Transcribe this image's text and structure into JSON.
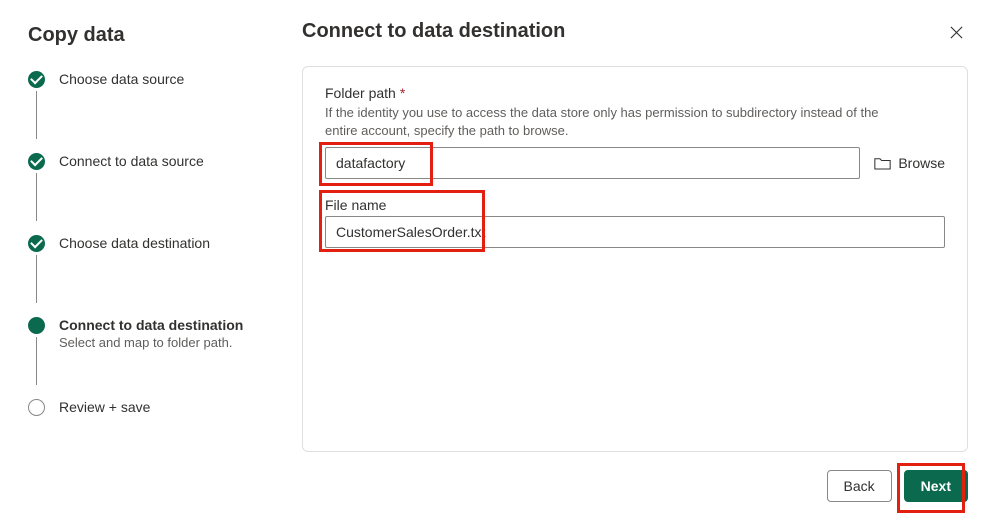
{
  "wizard": {
    "title": "Copy data",
    "steps": [
      {
        "label": "Choose data source",
        "status": "done"
      },
      {
        "label": "Connect to data source",
        "status": "done"
      },
      {
        "label": "Choose data destination",
        "status": "done"
      },
      {
        "label": "Connect to data destination",
        "status": "current",
        "sub": "Select and map to folder path."
      },
      {
        "label": "Review + save",
        "status": "pending"
      }
    ]
  },
  "page": {
    "title": "Connect to data destination"
  },
  "fields": {
    "folderPath": {
      "label": "Folder path",
      "required": true,
      "desc": "If the identity you use to access the data store only has permission to subdirectory instead of the entire account, specify the path to browse.",
      "value": "datafactory",
      "browse_label": "Browse"
    },
    "fileName": {
      "label": "File name",
      "value": "CustomerSalesOrder.txt"
    }
  },
  "footer": {
    "back": "Back",
    "next": "Next"
  }
}
